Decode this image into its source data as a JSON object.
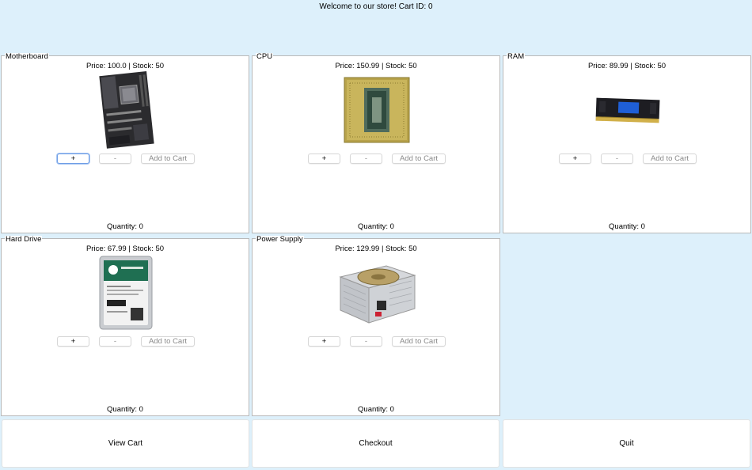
{
  "header": {
    "title": "Welcome to our store! Cart ID: 0"
  },
  "products": [
    {
      "name": "Motherboard",
      "price_text": "Price: 100.0 | Stock: 50",
      "quantity_text": "Quantity: 0",
      "image_icon": "motherboard-image"
    },
    {
      "name": "CPU",
      "price_text": "Price: 150.99 | Stock: 50",
      "quantity_text": "Quantity: 0",
      "image_icon": "cpu-image"
    },
    {
      "name": "RAM",
      "price_text": "Price: 89.99 | Stock: 50",
      "quantity_text": "Quantity: 0",
      "image_icon": "ram-image"
    },
    {
      "name": "Hard Drive",
      "price_text": "Price: 67.99 | Stock: 50",
      "quantity_text": "Quantity: 0",
      "image_icon": "hard-drive-image"
    },
    {
      "name": "Power Supply",
      "price_text": "Price: 129.99 | Stock: 50",
      "quantity_text": "Quantity: 0",
      "image_icon": "power-supply-image"
    }
  ],
  "controls": {
    "plus_label": "+",
    "minus_label": "-",
    "add_label": "Add to Cart"
  },
  "footer": {
    "view_cart_label": "View Cart",
    "checkout_label": "Checkout",
    "quit_label": "Quit"
  },
  "colors": {
    "background": "#ddf0fb",
    "panel": "#ffffff",
    "focus": "#6f9ee6"
  }
}
